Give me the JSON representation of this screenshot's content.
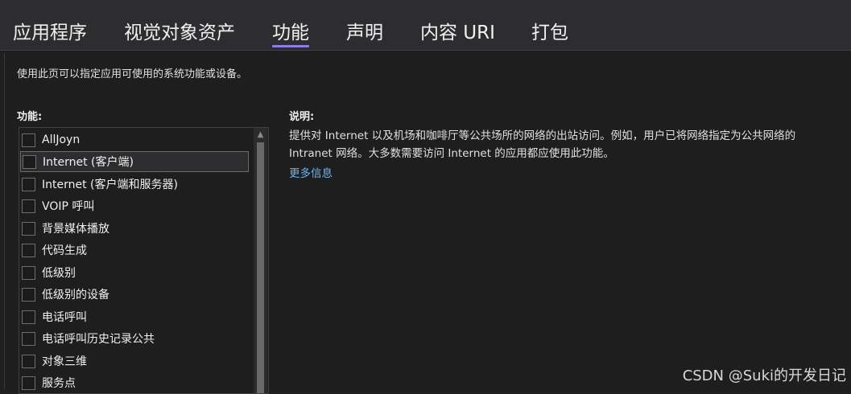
{
  "tabs": [
    {
      "label": "应用程序"
    },
    {
      "label": "视觉对象资产"
    },
    {
      "label": "功能",
      "active": true
    },
    {
      "label": "声明"
    },
    {
      "label": "内容 URI"
    },
    {
      "label": "打包"
    }
  ],
  "page": {
    "hint": "使用此页可以指定应用可使用的系统功能或设备。",
    "capabilities_heading": "功能:",
    "description_heading": "说明:",
    "description_line1": "提供对 Internet 以及机场和咖啡厅等公共场所的网络的出站访问。例如，用户已将网络指定为公共网络的",
    "description_line2": "Intranet 网络。大多数需要访问 Internet 的应用都应使用此功能。",
    "more_info": "更多信息"
  },
  "capabilities": [
    {
      "label": "AllJoyn",
      "checked": false
    },
    {
      "label": "Internet (客户端)",
      "checked": false,
      "selected": true
    },
    {
      "label": "Internet (客户端和服务器)",
      "checked": false
    },
    {
      "label": "VOIP 呼叫",
      "checked": false
    },
    {
      "label": "背景媒体播放",
      "checked": false
    },
    {
      "label": "代码生成",
      "checked": false
    },
    {
      "label": "低级别",
      "checked": false
    },
    {
      "label": "低级别的设备",
      "checked": false
    },
    {
      "label": "电话呼叫",
      "checked": false
    },
    {
      "label": "电话呼叫历史记录公共",
      "checked": false
    },
    {
      "label": "对象三维",
      "checked": false
    },
    {
      "label": "服务点",
      "checked": false
    }
  ],
  "watermark": "CSDN @Suki的开发日记",
  "icons": {
    "scroll_up": "triangle-up"
  },
  "colors": {
    "accent": "#8c7ee8",
    "link": "#6db4f0"
  }
}
